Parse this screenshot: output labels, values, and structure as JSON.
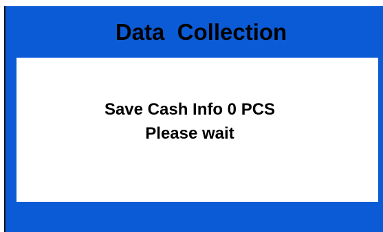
{
  "window": {
    "title": "Data  Collection"
  },
  "message": {
    "line1": "Save Cash Info 0 PCS",
    "line2": "Please wait"
  },
  "colors": {
    "background": "#0b5bd6",
    "panel": "#ffffff",
    "text": "#000000"
  }
}
